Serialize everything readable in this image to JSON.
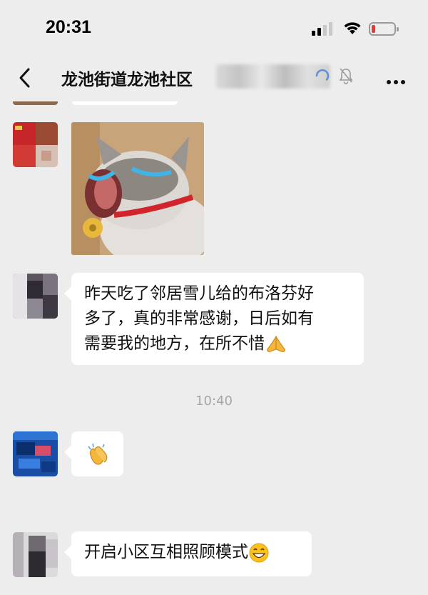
{
  "status_bar": {
    "time": "20:31"
  },
  "nav": {
    "title": "龙池街道龙池社区"
  },
  "messages": [
    {
      "type": "image",
      "content": "crying-cat-sticker"
    },
    {
      "type": "text",
      "lines": [
        "昨天吃了邻居雪儿给的布洛芬好",
        "多了，真的非常感谢，日后如有",
        "需要我的地方，在所不惜"
      ],
      "trailing_emoji": "pray-emoji"
    },
    {
      "type": "time",
      "text": "10:40"
    },
    {
      "type": "emoji",
      "content": "clapping-hands-emoji"
    },
    {
      "type": "text",
      "lines": [
        "开启小区互相照顾模式"
      ],
      "trailing_emoji": "grin-emoji"
    }
  ],
  "colors": {
    "background": "#ededed",
    "bubble": "#ffffff",
    "battery_low": "#e53935"
  }
}
